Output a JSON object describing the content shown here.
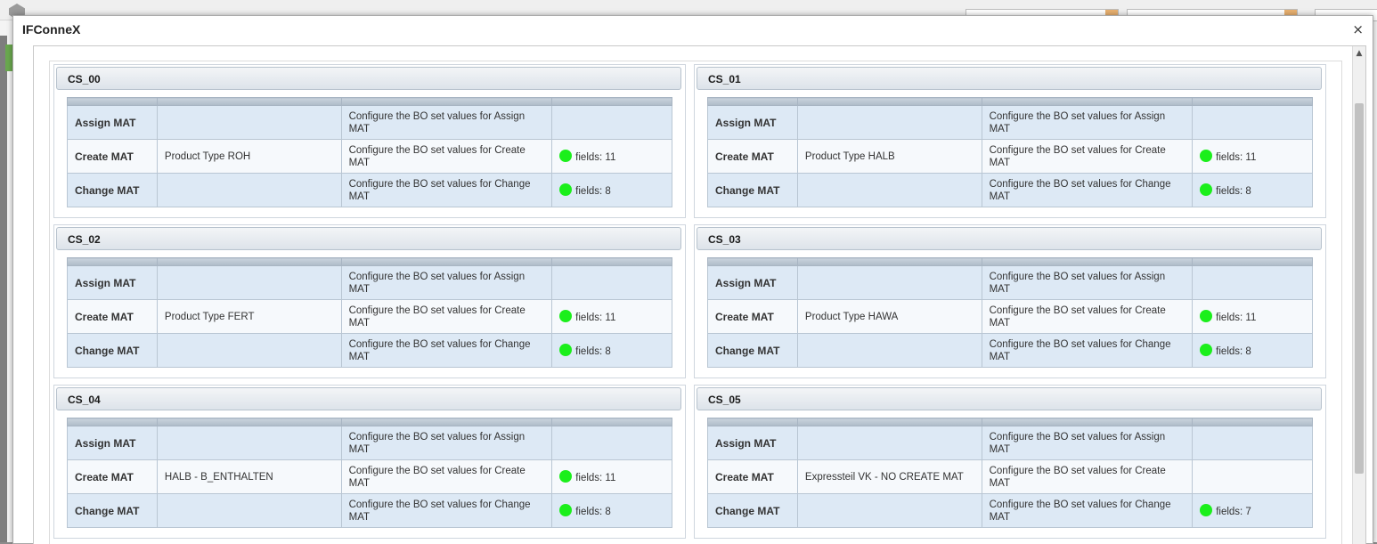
{
  "modal": {
    "title": "IFConneX",
    "close_glyph": "×"
  },
  "status_color": "#1bef1b",
  "panels": [
    {
      "name": "CS_00",
      "rows": [
        {
          "action": "Assign MAT",
          "description": "",
          "config": "Configure the BO set values for Assign MAT",
          "fields": ""
        },
        {
          "action": "Create MAT",
          "description": "Product Type ROH",
          "config": "Configure the BO set values for Create MAT",
          "fields": "fields: 11"
        },
        {
          "action": "Change MAT",
          "description": "",
          "config": "Configure the BO set values for Change MAT",
          "fields": "fields: 8"
        }
      ]
    },
    {
      "name": "CS_01",
      "rows": [
        {
          "action": "Assign MAT",
          "description": "",
          "config": "Configure the BO set values for Assign MAT",
          "fields": ""
        },
        {
          "action": "Create MAT",
          "description": "Product Type HALB",
          "config": "Configure the BO set values for Create MAT",
          "fields": "fields: 11"
        },
        {
          "action": "Change MAT",
          "description": "",
          "config": "Configure the BO set values for Change MAT",
          "fields": "fields: 8"
        }
      ]
    },
    {
      "name": "CS_02",
      "rows": [
        {
          "action": "Assign MAT",
          "description": "",
          "config": "Configure the BO set values for Assign MAT",
          "fields": ""
        },
        {
          "action": "Create MAT",
          "description": "Product Type FERT",
          "config": "Configure the BO set values for Create MAT",
          "fields": "fields: 11"
        },
        {
          "action": "Change MAT",
          "description": "",
          "config": "Configure the BO set values for Change MAT",
          "fields": "fields: 8"
        }
      ]
    },
    {
      "name": "CS_03",
      "rows": [
        {
          "action": "Assign MAT",
          "description": "",
          "config": "Configure the BO set values for Assign MAT",
          "fields": ""
        },
        {
          "action": "Create MAT",
          "description": "Product Type HAWA",
          "config": "Configure the BO set values for Create MAT",
          "fields": "fields: 11"
        },
        {
          "action": "Change MAT",
          "description": "",
          "config": "Configure the BO set values for Change MAT",
          "fields": "fields: 8"
        }
      ]
    },
    {
      "name": "CS_04",
      "rows": [
        {
          "action": "Assign MAT",
          "description": "",
          "config": "Configure the BO set values for Assign MAT",
          "fields": ""
        },
        {
          "action": "Create MAT",
          "description": "HALB - B_ENTHALTEN",
          "config": "Configure the BO set values for Create MAT",
          "fields": "fields: 11"
        },
        {
          "action": "Change MAT",
          "description": "",
          "config": "Configure the BO set values for Change MAT",
          "fields": "fields: 8"
        }
      ]
    },
    {
      "name": "CS_05",
      "rows": [
        {
          "action": "Assign MAT",
          "description": "",
          "config": "Configure the BO set values for Assign MAT",
          "fields": ""
        },
        {
          "action": "Create MAT",
          "description": "Expressteil VK - NO CREATE MAT",
          "config": "Configure the BO set values for Create MAT",
          "fields": ""
        },
        {
          "action": "Change MAT",
          "description": "",
          "config": "Configure the BO set values for Change MAT",
          "fields": "fields: 7"
        }
      ]
    }
  ]
}
